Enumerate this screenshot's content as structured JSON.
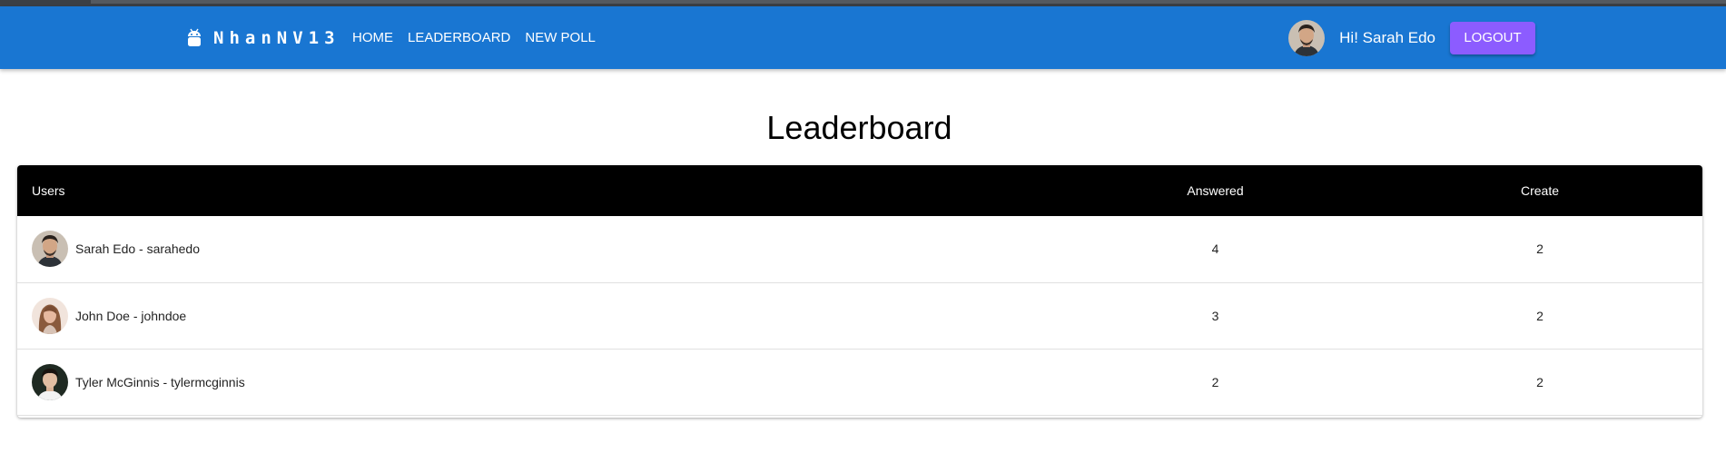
{
  "app": {
    "brand": "NhanNV13",
    "brand_icon": "android-icon"
  },
  "nav": {
    "items": [
      {
        "label": "HOME"
      },
      {
        "label": "LEADERBOARD"
      },
      {
        "label": "NEW POLL"
      }
    ]
  },
  "user": {
    "greeting": "Hi! Sarah Edo",
    "logout_label": "LOGOUT"
  },
  "page": {
    "title": "Leaderboard"
  },
  "table": {
    "headers": {
      "users": "Users",
      "answered": "Answered",
      "create": "Create"
    },
    "rows": [
      {
        "user": "Sarah Edo - sarahedo",
        "answered": "4",
        "create": "2"
      },
      {
        "user": "John Doe - johndoe",
        "answered": "3",
        "create": "2"
      },
      {
        "user": "Tyler McGinnis - tylermcginnis",
        "answered": "2",
        "create": "2"
      }
    ]
  },
  "colors": {
    "appbar": "#1976d2",
    "logout_button": "#8c5cff",
    "table_header": "#000000"
  }
}
